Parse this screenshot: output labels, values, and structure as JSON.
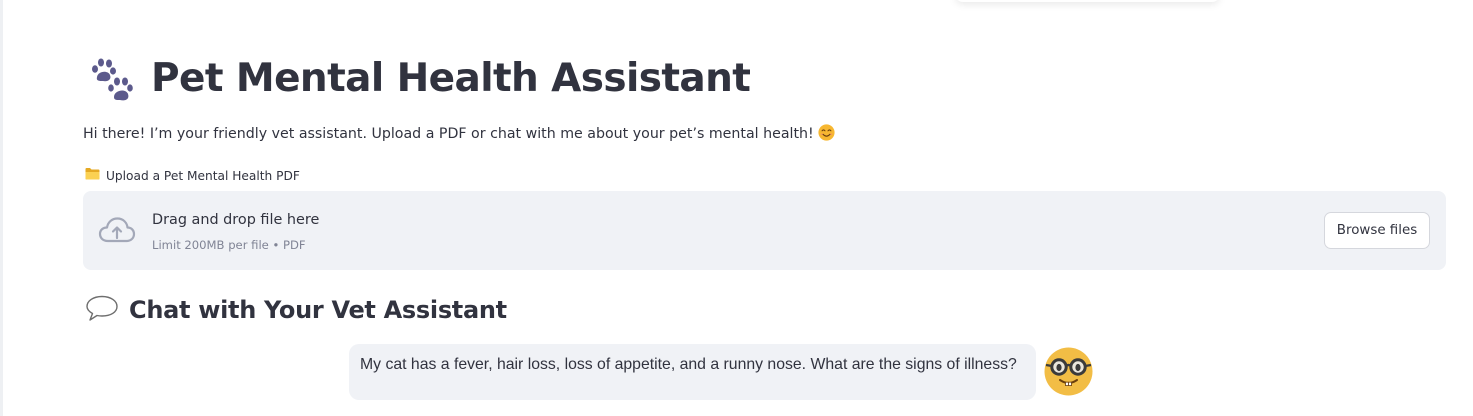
{
  "page": {
    "title": "Pet Mental Health Assistant",
    "title_icon": "paw-prints-icon",
    "intro": "Hi there! I’m your friendly vet assistant. Upload a PDF or chat with me about your pet’s mental health!",
    "intro_emoji": "smiling-face-icon"
  },
  "uploader": {
    "label": "Upload a Pet Mental Health PDF",
    "label_icon": "folder-icon",
    "dropzone_title": "Drag and drop file here",
    "dropzone_limit": "Limit 200MB per file • PDF",
    "browse_label": "Browse files",
    "upload_icon": "cloud-upload-icon"
  },
  "chat": {
    "heading": "Chat with Your Vet Assistant",
    "heading_icon": "speech-balloon-icon",
    "messages": [
      {
        "role": "user",
        "text": "My cat has a fever, hair loss, loss of appetite, and a runny nose. What are the signs of illness?",
        "avatar": "nerd-face-icon"
      }
    ]
  },
  "colors": {
    "text": "#31333f",
    "muted": "#808495",
    "panel": "#f0f2f6",
    "paw": "#5c5a8c",
    "avatar": "#f2bd45"
  }
}
